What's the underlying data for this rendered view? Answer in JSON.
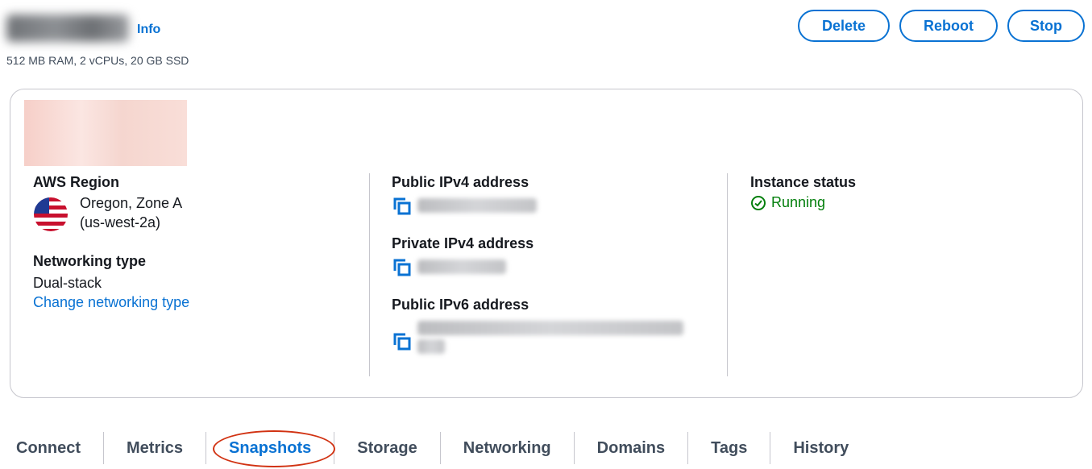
{
  "header": {
    "info_label": "Info",
    "subtitle": "512 MB RAM, 2 vCPUs, 20 GB SSD",
    "actions": {
      "delete": "Delete",
      "reboot": "Reboot",
      "stop": "Stop"
    }
  },
  "details": {
    "region": {
      "label": "AWS Region",
      "location": "Oregon, Zone A",
      "code": "(us-west-2a)",
      "flag_icon": "us-flag-icon"
    },
    "networking": {
      "label": "Networking type",
      "value": "Dual-stack",
      "change_link": "Change networking type"
    },
    "public_ipv4": {
      "label": "Public IPv4 address"
    },
    "private_ipv4": {
      "label": "Private IPv4 address"
    },
    "public_ipv6": {
      "label": "Public IPv6 address"
    },
    "status": {
      "label": "Instance status",
      "value": "Running",
      "color": "#037f0c"
    }
  },
  "tabs": [
    "Connect",
    "Metrics",
    "Snapshots",
    "Storage",
    "Networking",
    "Domains",
    "Tags",
    "History"
  ],
  "active_tab": "Snapshots",
  "colors": {
    "accent": "#0972d3",
    "highlight_circle": "#d13212"
  }
}
